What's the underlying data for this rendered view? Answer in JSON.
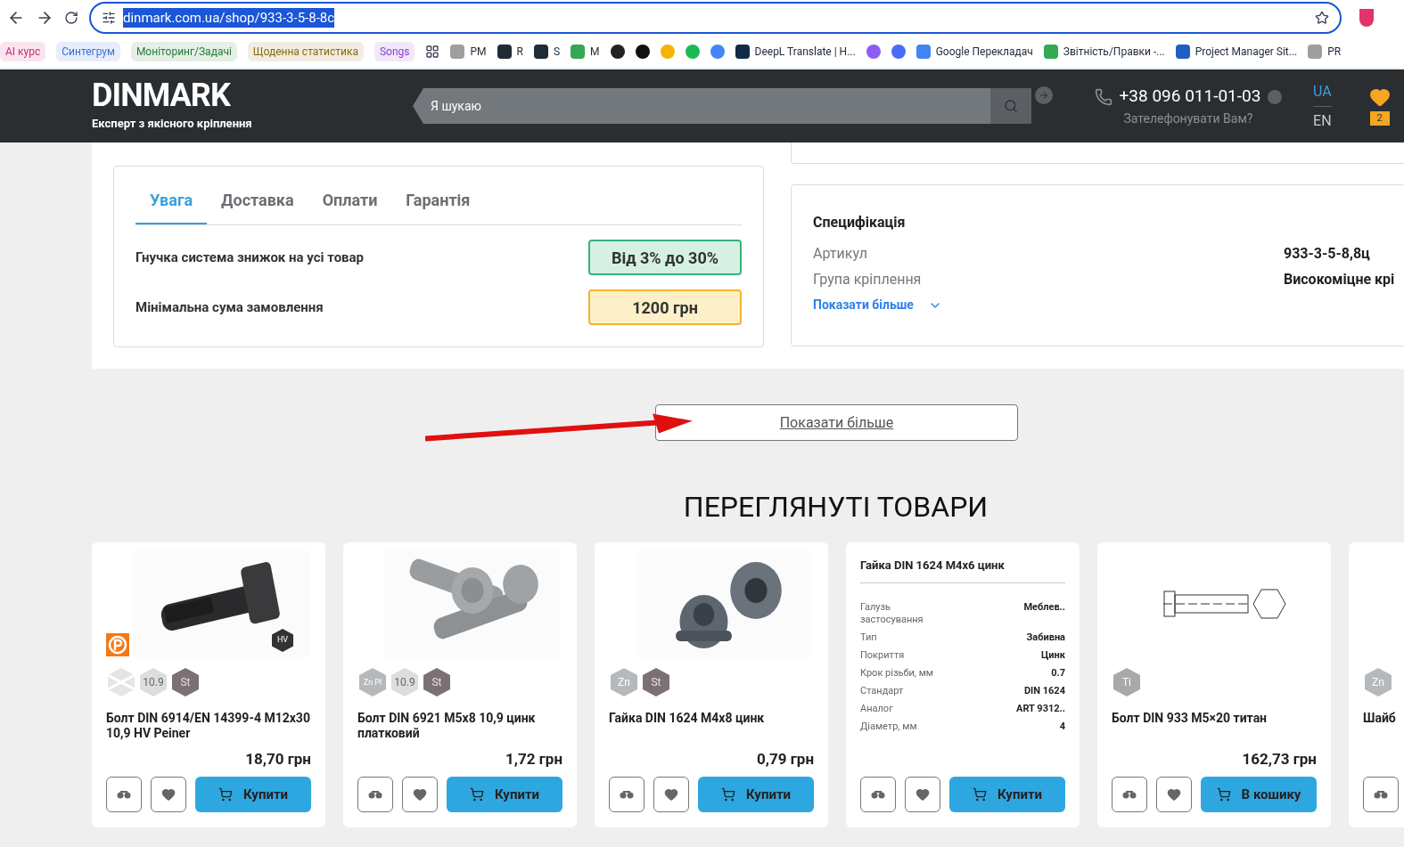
{
  "browser": {
    "url": "dinmark.com.ua/shop/933-3-5-8-8c",
    "url_selected": true,
    "bookmarks": [
      {
        "kind": "chip",
        "label": "AI курс",
        "color": "#d0287a"
      },
      {
        "kind": "chip",
        "label": "Синтегрум",
        "color": "#3b6fd8"
      },
      {
        "kind": "chip",
        "label": "Моніторинг/Задачі",
        "color": "#2a7a3a"
      },
      {
        "kind": "chip",
        "label": "Щоденна статистика",
        "color": "#8a6a10"
      },
      {
        "kind": "chip",
        "label": "Songs",
        "color": "#8a3fd0"
      },
      {
        "kind": "apps"
      },
      {
        "kind": "link",
        "label": "PM",
        "color": "#9e9e9e"
      },
      {
        "kind": "link",
        "label": "R",
        "color": "#1f2b36"
      },
      {
        "kind": "link",
        "label": "S",
        "color": "#1f2b36"
      },
      {
        "kind": "link",
        "label": "M",
        "color": "#34a853"
      },
      {
        "kind": "icon",
        "color": "#222222"
      },
      {
        "kind": "icon",
        "color": "#111111"
      },
      {
        "kind": "icon",
        "color": "#f4b400"
      },
      {
        "kind": "icon",
        "color": "#1db954"
      },
      {
        "kind": "icon",
        "color": "#4285f4"
      },
      {
        "kind": "link",
        "label": "DeepL Translate | H...",
        "color": "#0f2b46"
      },
      {
        "kind": "icon",
        "color": "#8b5cf6"
      },
      {
        "kind": "icon",
        "color": "#4a6cf7"
      },
      {
        "kind": "link",
        "label": "Google Перекладач",
        "color": "#4285f4"
      },
      {
        "kind": "link",
        "label": "Звітність/Правки -...",
        "color": "#34a853"
      },
      {
        "kind": "link",
        "label": "Project Manager Sit...",
        "color": "#1f5fc4"
      },
      {
        "kind": "link",
        "label": "PR",
        "color": "#9e9e9e"
      }
    ]
  },
  "header": {
    "logo": "DINMARK",
    "tagline": "Експерт з якісного кріплення",
    "search_placeholder": "Я шукаю",
    "phone": "+38 096 011-01-03",
    "callback": "Зателефонувати Вам?",
    "languages": [
      {
        "label": "UA",
        "selected": true
      },
      {
        "label": "EN",
        "selected": false
      }
    ],
    "favorites_count": "2"
  },
  "info": {
    "tabs": [
      {
        "label": "Увага",
        "selected": true
      },
      {
        "label": "Доставка",
        "selected": false
      },
      {
        "label": "Оплати",
        "selected": false
      },
      {
        "label": "Гарантія",
        "selected": false
      }
    ],
    "rows": [
      {
        "label": "Гнучка система знижок на усі товар",
        "value": "Від 3% до 30%",
        "kind": "discount"
      },
      {
        "label": "Мінімальна сума замовлення",
        "value": "1200 грн",
        "kind": "minimum"
      }
    ]
  },
  "specification": {
    "title": "Специфікація",
    "rows": [
      {
        "label": "Артикул",
        "value": "933-3-5-8,8ц"
      },
      {
        "label": "Група кріплення",
        "value": "Високоміцне крі"
      }
    ],
    "show_more": "Показати більше"
  },
  "show_more_button": "Показати більше",
  "viewed": {
    "title": "ПЕРЕГЛЯНУТІ ТОВАРИ",
    "products": [
      {
        "brand_logo": true,
        "image_badge": "HV",
        "badges": [
          {
            "kind": "crossed"
          },
          {
            "kind": "text",
            "label": "10.9",
            "color": "#dcdddf"
          },
          {
            "kind": "text",
            "label": "St",
            "color": "#7d7073"
          }
        ],
        "title": "Болт DIN 6914/EN 14399-4 M12x30 10,9 HV Peiner",
        "price": "18,70 грн",
        "buy": "Купити"
      },
      {
        "brand_logo": false,
        "badges": [
          {
            "kind": "stack",
            "label": "Zn",
            "label2": "Pl",
            "color": "#b6b9bb"
          },
          {
            "kind": "text",
            "label": "10.9",
            "color": "#dcdddf"
          },
          {
            "kind": "text",
            "label": "St",
            "color": "#7d7073"
          }
        ],
        "title": "Болт DIN 6921 M5x8 10,9 цинк платковий",
        "price": "1,72 грн",
        "buy": "Купити"
      },
      {
        "brand_logo": false,
        "badges": [
          {
            "kind": "text",
            "label": "Zn",
            "color": "#b6b9bb"
          },
          {
            "kind": "text",
            "label": "St",
            "color": "#7d7073"
          }
        ],
        "title": "Гайка DIN 1624 M4x8 цинк",
        "price": "0,79 грн",
        "buy": "Купити"
      },
      {
        "kind": "specs",
        "title": "Гайка DIN 1624 M4x6 цинк",
        "specs": [
          {
            "label": "Галузь застосування",
            "value": "Меблев.."
          },
          {
            "label": "Тип",
            "value": "Забивна"
          },
          {
            "label": "Покриття",
            "value": "Цинк"
          },
          {
            "label": "Крок різьби, мм",
            "value": "0.7"
          },
          {
            "label": "Стандарт",
            "value": "DIN 1624"
          },
          {
            "label": "Аналог",
            "value": "ART 9312.."
          },
          {
            "label": "Діаметр, мм",
            "value": "4"
          }
        ],
        "buy": "Купити"
      },
      {
        "kind": "drawing",
        "brand_logo": false,
        "badges": [
          {
            "kind": "text",
            "label": "Ti",
            "color": "#a9a9a9"
          }
        ],
        "title": "Болт DIN 933 M5×20 титан",
        "price": "162,73 грн",
        "buy": "В кошику"
      },
      {
        "kind": "plain",
        "brand_logo": false,
        "badges": [
          {
            "kind": "text",
            "label": "Zn",
            "color": "#b6b9bb"
          }
        ],
        "title": "Шайб"
      }
    ]
  }
}
